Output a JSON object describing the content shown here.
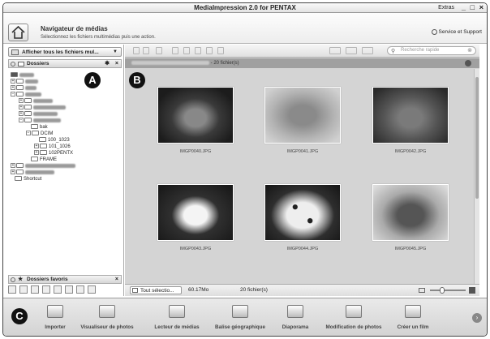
{
  "window": {
    "title": "MediaImpression 2.0 for PENTAX",
    "extras": "Extras",
    "minimize": "_",
    "maximize": "□",
    "close": "×"
  },
  "header": {
    "title": "Navigateur de médias",
    "subtitle": "Sélectionnez les fichiers multimédias puis une action.",
    "support": "Service et Support"
  },
  "left": {
    "filter_label": "Afficher tous les fichiers mul...",
    "folders_title": "Dossiers",
    "tree": [
      {
        "label": "bak"
      },
      {
        "label": "DCIM"
      },
      {
        "label": "100_1023"
      },
      {
        "label": "101_1026"
      },
      {
        "label": "102PENTX"
      },
      {
        "label": "FRAME"
      },
      {
        "label": "Shortcut"
      }
    ],
    "favorites_title": "Dossiers favoris"
  },
  "content": {
    "search_placeholder": "Recherche rapide",
    "count_label": "- 20 fichier(s)",
    "thumbnails": [
      {
        "name": "IMGP0040.JPG",
        "icon": "cat-photo"
      },
      {
        "name": "IMGP0041.JPG",
        "icon": "cat-photo"
      },
      {
        "name": "IMGP0042.JPG",
        "icon": "cat-photo"
      },
      {
        "name": "IMGP0043.JPG",
        "icon": "dog-photo"
      },
      {
        "name": "IMGP0044.JPG",
        "icon": "dalmatian-photo"
      },
      {
        "name": "IMGP0045.JPG",
        "icon": "spaniel-photo"
      }
    ],
    "status": {
      "select_all": "Tout sélectio...",
      "size": "60.17Mo",
      "files": "20 fichier(s)"
    }
  },
  "actions": [
    {
      "label": "Importer"
    },
    {
      "label": "Visualiseur de photos"
    },
    {
      "label": "Lecteur de médias"
    },
    {
      "label": "Balise géographique"
    },
    {
      "label": "Diaporama"
    },
    {
      "label": "Modification de photos"
    },
    {
      "label": "Créer un film"
    }
  ],
  "callouts": {
    "a": "A",
    "b": "B",
    "c": "C"
  }
}
